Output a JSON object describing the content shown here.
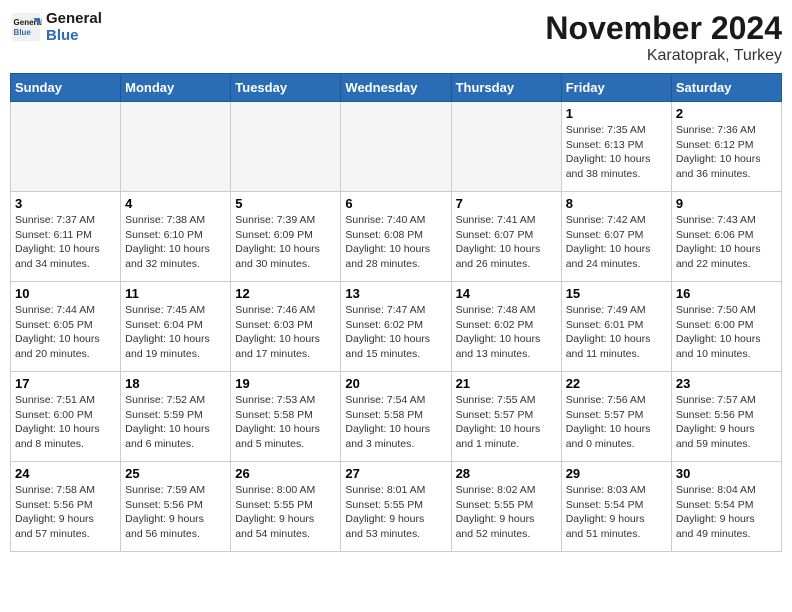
{
  "header": {
    "logo_line1": "General",
    "logo_line2": "Blue",
    "month_title": "November 2024",
    "location": "Karatoprak, Turkey"
  },
  "weekdays": [
    "Sunday",
    "Monday",
    "Tuesday",
    "Wednesday",
    "Thursday",
    "Friday",
    "Saturday"
  ],
  "weeks": [
    [
      {
        "day": "",
        "info": ""
      },
      {
        "day": "",
        "info": ""
      },
      {
        "day": "",
        "info": ""
      },
      {
        "day": "",
        "info": ""
      },
      {
        "day": "",
        "info": ""
      },
      {
        "day": "1",
        "info": "Sunrise: 7:35 AM\nSunset: 6:13 PM\nDaylight: 10 hours\nand 38 minutes."
      },
      {
        "day": "2",
        "info": "Sunrise: 7:36 AM\nSunset: 6:12 PM\nDaylight: 10 hours\nand 36 minutes."
      }
    ],
    [
      {
        "day": "3",
        "info": "Sunrise: 7:37 AM\nSunset: 6:11 PM\nDaylight: 10 hours\nand 34 minutes."
      },
      {
        "day": "4",
        "info": "Sunrise: 7:38 AM\nSunset: 6:10 PM\nDaylight: 10 hours\nand 32 minutes."
      },
      {
        "day": "5",
        "info": "Sunrise: 7:39 AM\nSunset: 6:09 PM\nDaylight: 10 hours\nand 30 minutes."
      },
      {
        "day": "6",
        "info": "Sunrise: 7:40 AM\nSunset: 6:08 PM\nDaylight: 10 hours\nand 28 minutes."
      },
      {
        "day": "7",
        "info": "Sunrise: 7:41 AM\nSunset: 6:07 PM\nDaylight: 10 hours\nand 26 minutes."
      },
      {
        "day": "8",
        "info": "Sunrise: 7:42 AM\nSunset: 6:07 PM\nDaylight: 10 hours\nand 24 minutes."
      },
      {
        "day": "9",
        "info": "Sunrise: 7:43 AM\nSunset: 6:06 PM\nDaylight: 10 hours\nand 22 minutes."
      }
    ],
    [
      {
        "day": "10",
        "info": "Sunrise: 7:44 AM\nSunset: 6:05 PM\nDaylight: 10 hours\nand 20 minutes."
      },
      {
        "day": "11",
        "info": "Sunrise: 7:45 AM\nSunset: 6:04 PM\nDaylight: 10 hours\nand 19 minutes."
      },
      {
        "day": "12",
        "info": "Sunrise: 7:46 AM\nSunset: 6:03 PM\nDaylight: 10 hours\nand 17 minutes."
      },
      {
        "day": "13",
        "info": "Sunrise: 7:47 AM\nSunset: 6:02 PM\nDaylight: 10 hours\nand 15 minutes."
      },
      {
        "day": "14",
        "info": "Sunrise: 7:48 AM\nSunset: 6:02 PM\nDaylight: 10 hours\nand 13 minutes."
      },
      {
        "day": "15",
        "info": "Sunrise: 7:49 AM\nSunset: 6:01 PM\nDaylight: 10 hours\nand 11 minutes."
      },
      {
        "day": "16",
        "info": "Sunrise: 7:50 AM\nSunset: 6:00 PM\nDaylight: 10 hours\nand 10 minutes."
      }
    ],
    [
      {
        "day": "17",
        "info": "Sunrise: 7:51 AM\nSunset: 6:00 PM\nDaylight: 10 hours\nand 8 minutes."
      },
      {
        "day": "18",
        "info": "Sunrise: 7:52 AM\nSunset: 5:59 PM\nDaylight: 10 hours\nand 6 minutes."
      },
      {
        "day": "19",
        "info": "Sunrise: 7:53 AM\nSunset: 5:58 PM\nDaylight: 10 hours\nand 5 minutes."
      },
      {
        "day": "20",
        "info": "Sunrise: 7:54 AM\nSunset: 5:58 PM\nDaylight: 10 hours\nand 3 minutes."
      },
      {
        "day": "21",
        "info": "Sunrise: 7:55 AM\nSunset: 5:57 PM\nDaylight: 10 hours\nand 1 minute."
      },
      {
        "day": "22",
        "info": "Sunrise: 7:56 AM\nSunset: 5:57 PM\nDaylight: 10 hours\nand 0 minutes."
      },
      {
        "day": "23",
        "info": "Sunrise: 7:57 AM\nSunset: 5:56 PM\nDaylight: 9 hours\nand 59 minutes."
      }
    ],
    [
      {
        "day": "24",
        "info": "Sunrise: 7:58 AM\nSunset: 5:56 PM\nDaylight: 9 hours\nand 57 minutes."
      },
      {
        "day": "25",
        "info": "Sunrise: 7:59 AM\nSunset: 5:56 PM\nDaylight: 9 hours\nand 56 minutes."
      },
      {
        "day": "26",
        "info": "Sunrise: 8:00 AM\nSunset: 5:55 PM\nDaylight: 9 hours\nand 54 minutes."
      },
      {
        "day": "27",
        "info": "Sunrise: 8:01 AM\nSunset: 5:55 PM\nDaylight: 9 hours\nand 53 minutes."
      },
      {
        "day": "28",
        "info": "Sunrise: 8:02 AM\nSunset: 5:55 PM\nDaylight: 9 hours\nand 52 minutes."
      },
      {
        "day": "29",
        "info": "Sunrise: 8:03 AM\nSunset: 5:54 PM\nDaylight: 9 hours\nand 51 minutes."
      },
      {
        "day": "30",
        "info": "Sunrise: 8:04 AM\nSunset: 5:54 PM\nDaylight: 9 hours\nand 49 minutes."
      }
    ]
  ]
}
